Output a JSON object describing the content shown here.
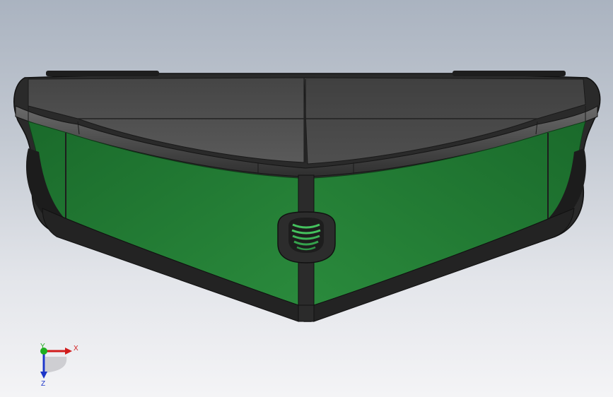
{
  "viewport": {
    "background_top": "#aab3c0",
    "background_bottom": "#f4f4f6"
  },
  "model": {
    "body_color": "#1f7a33",
    "frame_color": "#2b2b2b",
    "top_color": "#4a4a4a"
  },
  "triad": {
    "x_label": "X",
    "y_label": "Y",
    "z_label": "Z",
    "x_color": "#d11c1c",
    "y_color": "#1fae1f",
    "z_color": "#1d36c8"
  }
}
